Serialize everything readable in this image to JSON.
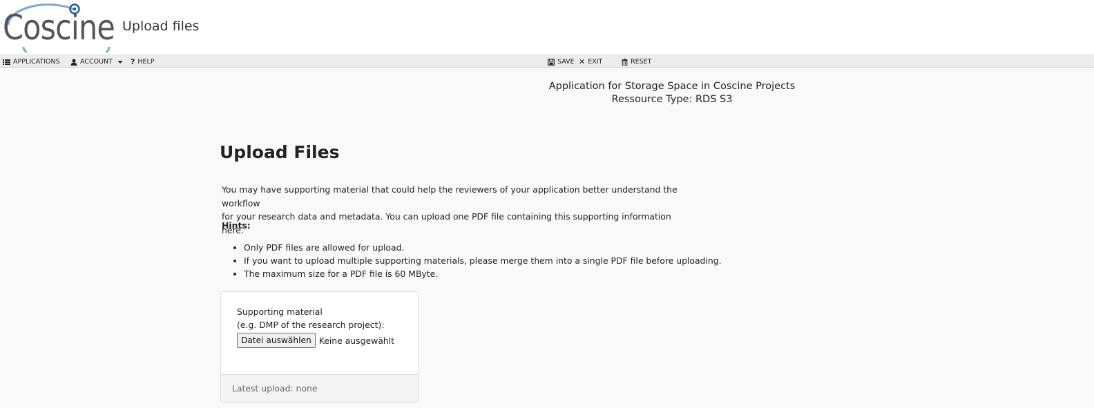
{
  "header": {
    "logo_text": "Coscine",
    "app_title": "Upload files"
  },
  "toolbar": {
    "applications": "APPLICATIONS",
    "account": "ACCOUNT",
    "help": "HELP",
    "save": "SAVE",
    "exit": "EXIT",
    "reset": "RESET"
  },
  "application": {
    "line1": "Application for Storage Space in Coscine Projects",
    "line2": "Ressource Type: RDS S3"
  },
  "main": {
    "title": "Upload Files",
    "intro_line1": "You may have supporting material that could help the reviewers of your application better understand the workflow",
    "intro_line2": "for your research data and metadata. You can upload one PDF file containing this supporting information here.",
    "hints_title": "Hints:",
    "hints": [
      "Only PDF files are allowed for upload.",
      "If you want to upload multiple supporting materials, please merge them into a single PDF file before uploading.",
      "The maximum size for a PDF file is 60 MByte."
    ]
  },
  "upload_card": {
    "label_line1": "Supporting material",
    "label_line2": "(e.g. DMP of the research project):",
    "choose_button": "Datei auswählen",
    "no_file": "Keine ausgewählt",
    "latest_upload": "Latest upload: none"
  },
  "colors": {
    "logo_arc": "#7fa7d6",
    "logo_ring": "#1f5fa8",
    "toolbar_bg": "#ececec",
    "page_bg": "#f9f9f9"
  },
  "icons": {
    "applications": "list-icon",
    "account": "user-icon",
    "account_caret": "caret-down-icon",
    "help": "question-icon",
    "save": "save-icon",
    "exit": "close-icon",
    "reset": "trash-icon"
  }
}
